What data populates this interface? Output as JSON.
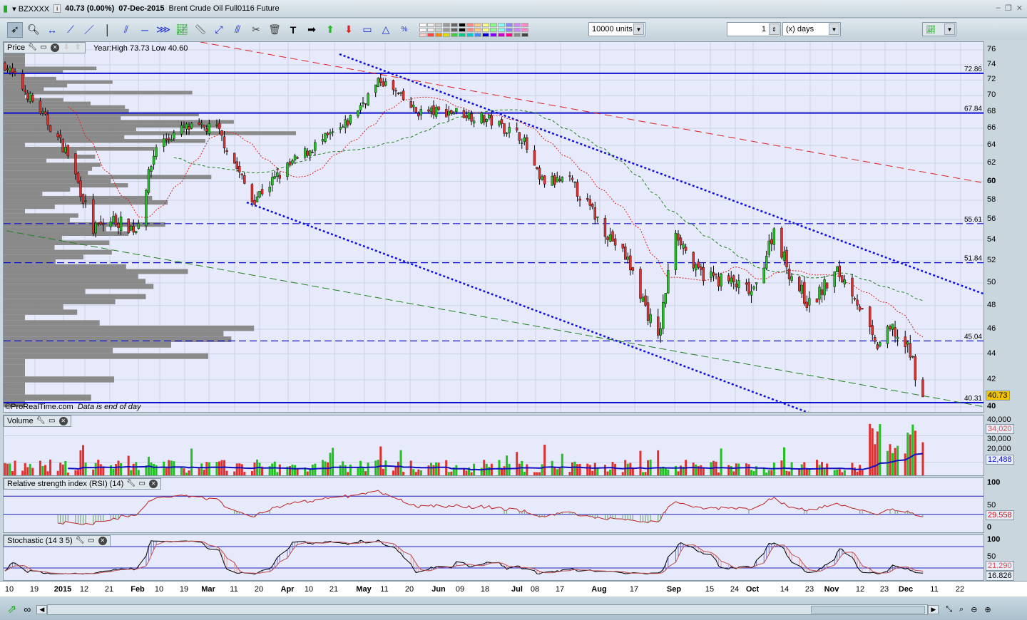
{
  "title": {
    "symbol": "BZXXXX",
    "price": "40.73 (0.00%)",
    "date": "07-Dec-2015",
    "name": "Brent Crude Oil Full0116 Future"
  },
  "toolbar": {
    "tools": [
      "pointer",
      "zoom",
      "horizontal-line",
      "segment",
      "line",
      "vertical-line",
      "channel",
      "horizontal-ray",
      "fan",
      "trading-system",
      "ruler",
      "point-line",
      "parallel-line",
      "settings",
      "delete",
      "text",
      "arrow",
      "buy-arrow",
      "sell-arrow",
      "rectangle",
      "triangle",
      "fibonacci"
    ],
    "units": "10000 units",
    "period_value": "1",
    "period_unit": "(x) days"
  },
  "price_panel": {
    "label": "Price",
    "info": "Year:High 73.73 Low 40.60",
    "watermark": "©ProRealTime.com",
    "note": "Data is end of day",
    "last": "40.73",
    "levels": [
      {
        "v": 72.86,
        "label": "72.86",
        "style": "solid"
      },
      {
        "v": 67.84,
        "label": "67.84",
        "style": "solid"
      },
      {
        "v": 55.61,
        "label": "55.61",
        "style": "dashed"
      },
      {
        "v": 51.84,
        "label": "51.84",
        "style": "dashed"
      },
      {
        "v": 45.04,
        "label": "45.04",
        "style": "dashed"
      },
      {
        "v": 40.31,
        "label": "40.31",
        "style": "solid"
      }
    ],
    "ticks": [
      "76",
      "74",
      "72",
      "70",
      "68",
      "66",
      "64",
      "62",
      "60",
      "58",
      "56",
      "54",
      "52",
      "50",
      "48",
      "46",
      "44",
      "42",
      "40"
    ]
  },
  "volume_panel": {
    "label": "Volume",
    "ticks": [
      "40,000",
      "30,000",
      "20,000"
    ],
    "last": "34,020",
    "ma": "12,488"
  },
  "rsi_panel": {
    "label": "Relative strength index (RSI) (14)",
    "ticks": [
      "100",
      "50",
      "0"
    ],
    "last": "29.558"
  },
  "stoch_panel": {
    "label": "Stochastic (14 3 5)",
    "ticks": [
      "100",
      "50"
    ],
    "k": "21.290",
    "d": "16.826"
  },
  "date_ticks": [
    [
      "10",
      0
    ],
    [
      "19",
      0
    ],
    [
      "2015",
      1
    ],
    [
      "12",
      0
    ],
    [
      "21",
      0
    ],
    [
      "Feb",
      1
    ],
    [
      "10",
      0
    ],
    [
      "19",
      0
    ],
    [
      "Mar",
      1
    ],
    [
      "11",
      0
    ],
    [
      "20",
      0
    ],
    [
      "Apr",
      1
    ],
    [
      "10",
      0
    ],
    [
      "21",
      0
    ],
    [
      "May",
      1
    ],
    [
      "11",
      0
    ],
    [
      "20",
      0
    ],
    [
      "Jun",
      1
    ],
    [
      "09",
      0
    ],
    [
      "18",
      0
    ],
    [
      "Jul",
      1
    ],
    [
      "08",
      0
    ],
    [
      "17",
      0
    ],
    [
      "Aug",
      1
    ],
    [
      "17",
      0
    ],
    [
      "Sep",
      1
    ],
    [
      "15",
      0
    ],
    [
      "24",
      0
    ],
    [
      "Oct",
      1
    ],
    [
      "14",
      0
    ],
    [
      "23",
      0
    ],
    [
      "Nov",
      1
    ],
    [
      "12",
      0
    ],
    [
      "23",
      0
    ],
    [
      "Dec",
      1
    ],
    [
      "11",
      0
    ],
    [
      "22",
      0
    ]
  ],
  "chart_data": {
    "type": "candlestick",
    "title": "Brent Crude Oil Full0116 Future",
    "ylim": [
      40,
      76
    ],
    "yscale": "log",
    "keypoints": [
      [
        "2014-12-08",
        74
      ],
      [
        "2014-12-22",
        68
      ],
      [
        "2015-01-02",
        63
      ],
      [
        "2015-01-12",
        55
      ],
      [
        "2015-01-20",
        56
      ],
      [
        "2015-01-29",
        55
      ],
      [
        "2015-02-06",
        64
      ],
      [
        "2015-02-17",
        66
      ],
      [
        "2015-03-02",
        66
      ],
      [
        "2015-03-16",
        58
      ],
      [
        "2015-04-01",
        62
      ],
      [
        "2015-04-10",
        64
      ],
      [
        "2015-04-21",
        66
      ],
      [
        "2015-05-06",
        72
      ],
      [
        "2015-05-20",
        68
      ],
      [
        "2015-06-05",
        68
      ],
      [
        "2015-06-18",
        67
      ],
      [
        "2015-07-01",
        65
      ],
      [
        "2015-07-08",
        60
      ],
      [
        "2015-07-20",
        60
      ],
      [
        "2015-08-03",
        55
      ],
      [
        "2015-08-12",
        52
      ],
      [
        "2015-08-24",
        45
      ],
      [
        "2015-08-31",
        55
      ],
      [
        "2015-09-08",
        51
      ],
      [
        "2015-09-22",
        50
      ],
      [
        "2015-10-01",
        49
      ],
      [
        "2015-10-09",
        55
      ],
      [
        "2015-10-15",
        51
      ],
      [
        "2015-10-23",
        48
      ],
      [
        "2015-11-03",
        51
      ],
      [
        "2015-11-10",
        49
      ],
      [
        "2015-11-18",
        44.5
      ],
      [
        "2015-11-25",
        46
      ],
      [
        "2015-12-02",
        44
      ],
      [
        "2015-12-07",
        40.73
      ]
    ]
  },
  "colors": {
    "up": "#22c022",
    "down": "#e03030",
    "level": "#1010d0",
    "trend_red": "#e02020",
    "plot_bg": "#e6eafa"
  }
}
